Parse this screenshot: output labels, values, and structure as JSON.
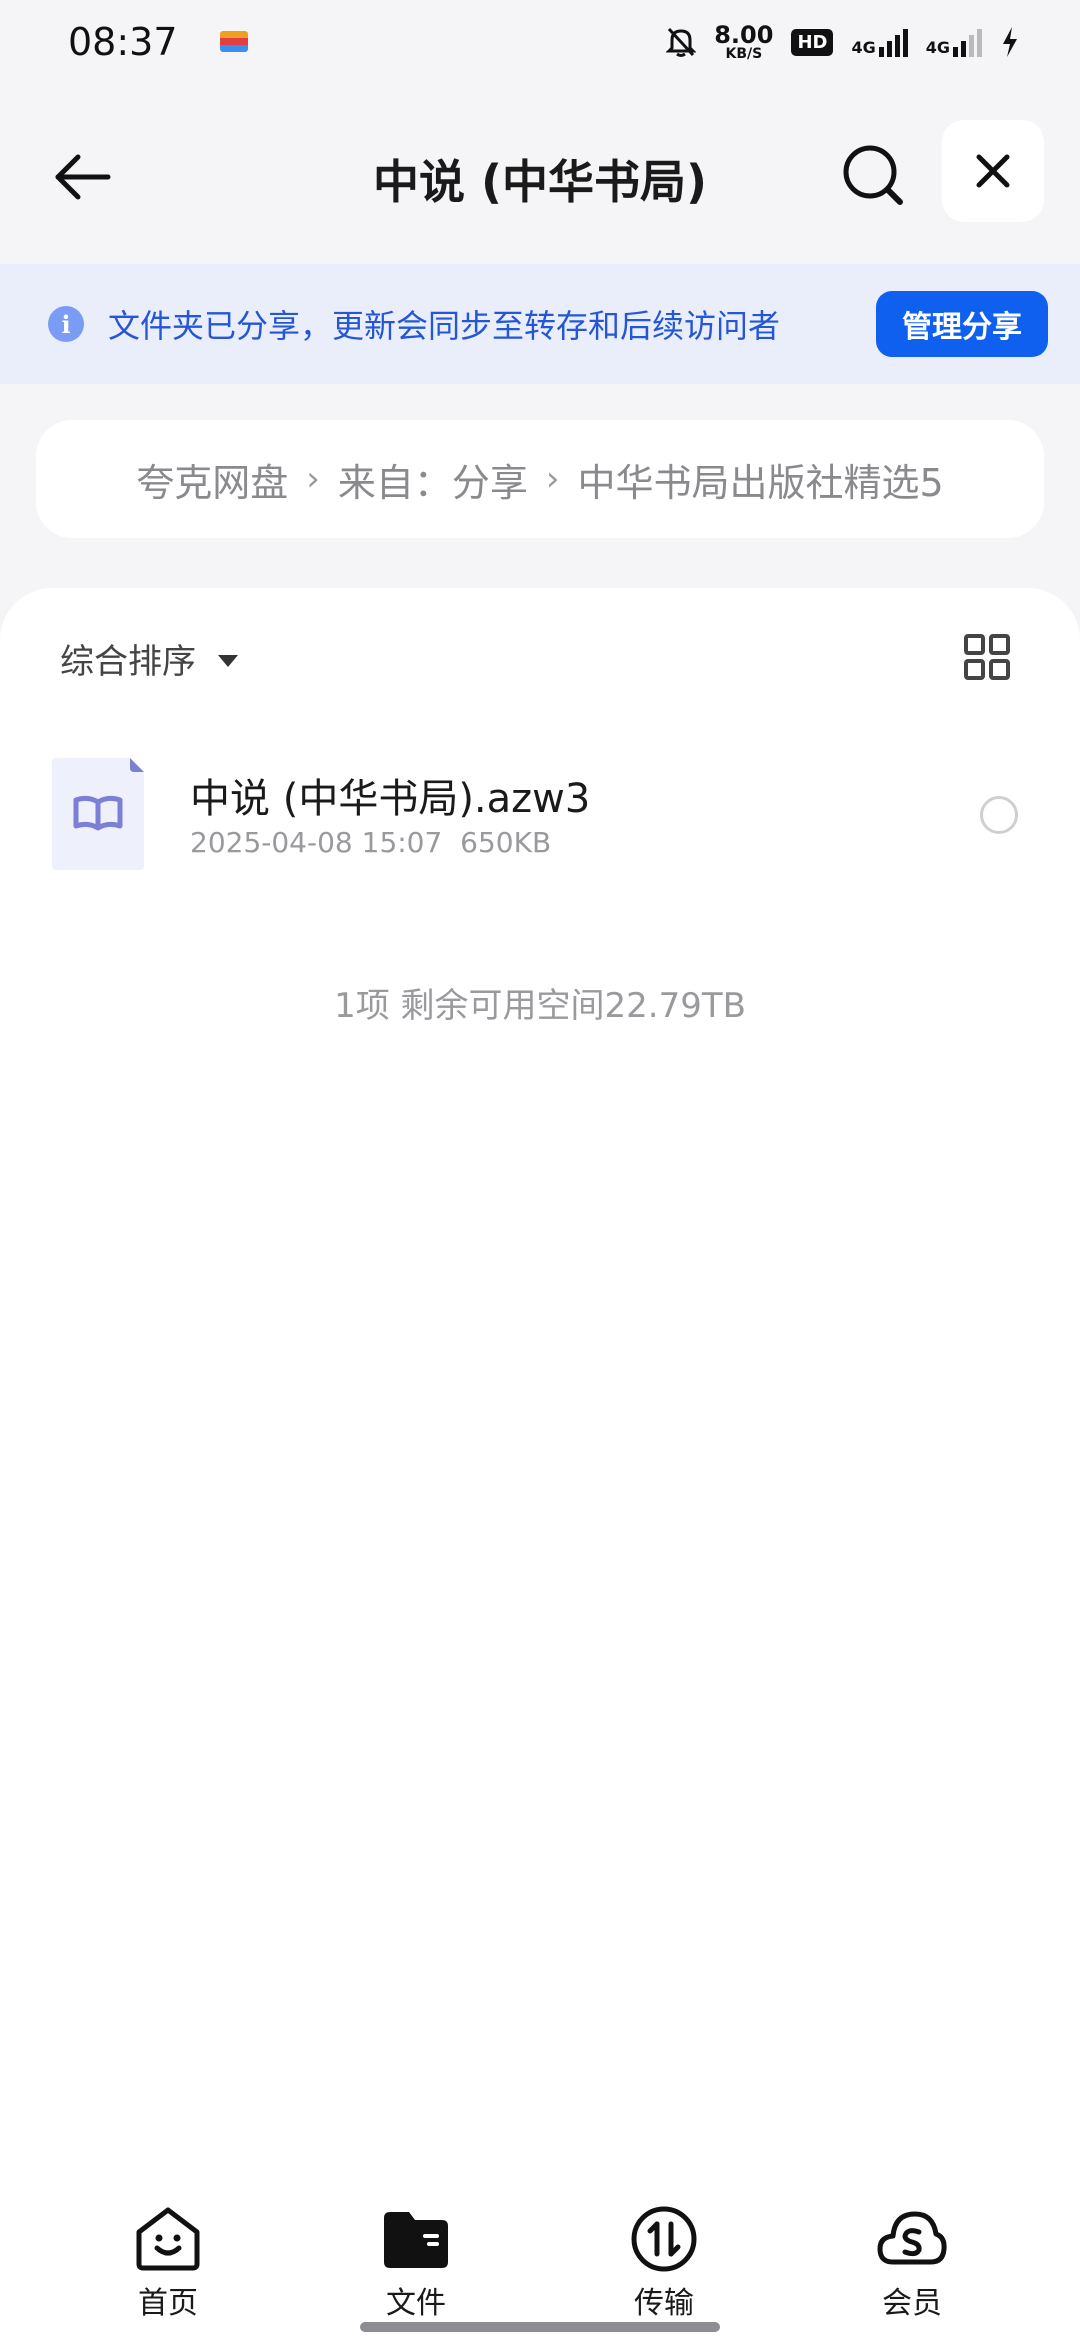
{
  "status_bar": {
    "time": "08:37",
    "speed_value": "8.00",
    "speed_unit": "KB/S",
    "hd_label": "HD",
    "net1": "4G",
    "net2": "4G"
  },
  "header": {
    "title": "中说 (中华书局)"
  },
  "banner": {
    "text": "文件夹已分享，更新会同步至转存和后续访问者",
    "manage_label": "管理分享"
  },
  "breadcrumb": {
    "items": [
      "夸克网盘",
      "来自：分享",
      "中华书局出版社精选5"
    ]
  },
  "toolbar": {
    "sort_label": "综合排序"
  },
  "files": [
    {
      "name": "中说 (中华书局).azw3",
      "date": "2025-04-08 15:07",
      "size": "650KB"
    }
  ],
  "footer_info": "1项 剩余可用空间22.79TB",
  "nav": {
    "items": [
      {
        "label": "首页",
        "icon": "home-smile-icon"
      },
      {
        "label": "文件",
        "icon": "folder-icon"
      },
      {
        "label": "传输",
        "icon": "transfer-icon"
      },
      {
        "label": "会员",
        "icon": "member-cloud-icon"
      }
    ]
  },
  "colors": {
    "accent": "#1060f0",
    "banner_bg": "#e9eefa",
    "banner_text": "#2456d6"
  }
}
